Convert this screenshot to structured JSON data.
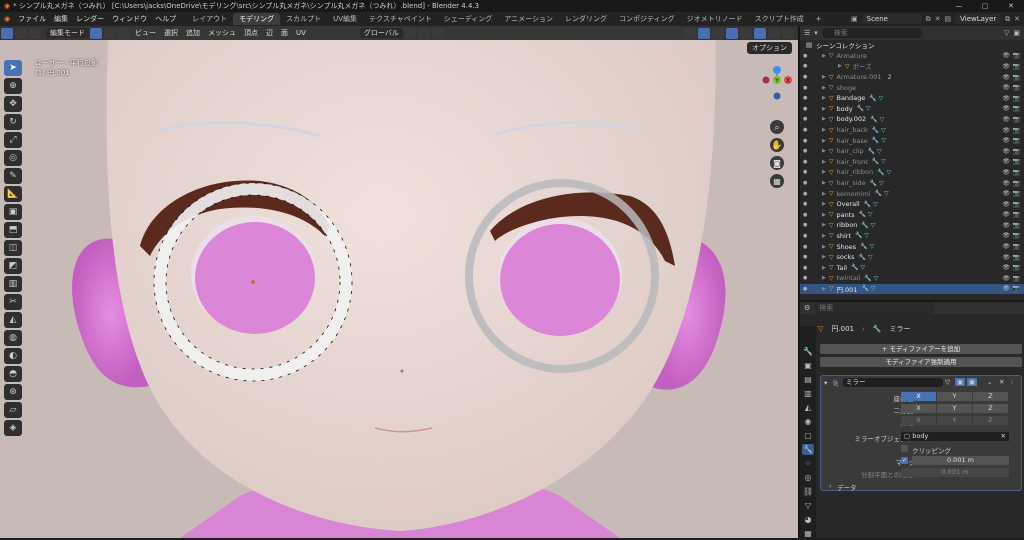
{
  "window": {
    "title": "* シンプル丸メガネ（つみれ） [C:\\Users\\jacks\\OneDrive\\モデリング\\src\\シンプル丸メガネ\\シンプル丸メガネ（つみれ）.blend] - Blender 4.4.3",
    "controls": [
      "—",
      "▢",
      "✕"
    ]
  },
  "menubar": {
    "menus": [
      "ファイル",
      "編集",
      "レンダー",
      "ウィンドウ",
      "ヘルプ"
    ],
    "workspaces": [
      "レイアウト",
      "モデリング",
      "スカルプト",
      "UV編集",
      "テクスチャペイント",
      "シェーディング",
      "アニメーション",
      "レンダリング",
      "コンポジティング",
      "ジオメトリノード",
      "スクリプト作成",
      "+"
    ],
    "active_workspace": "モデリング",
    "scene": "Scene",
    "view_layer": "ViewLayer"
  },
  "viewport": {
    "mode": "編集モード",
    "menus": [
      "ビュー",
      "選択",
      "追加",
      "メッシュ",
      "頂点",
      "辺",
      "面",
      "UV"
    ],
    "transform_orientation": "グローバル",
    "options": "オプション",
    "view_name": "ユーザー・平行投影",
    "object_name": "(1) 円.001",
    "gizmo_axes": [
      "X",
      "Y",
      "Z"
    ],
    "colors": {
      "x": "#e8474f",
      "y": "#7cc22e",
      "z": "#3f8ff2"
    }
  },
  "outliner": {
    "search_placeholder": "検索",
    "root": "シーンコレクション",
    "items": [
      {
        "label": "Armature",
        "dim": true,
        "sub": ""
      },
      {
        "label": "ポーズ",
        "dim": true,
        "sub": ""
      },
      {
        "label": "Armature.001",
        "dim": true,
        "sub": "2"
      },
      {
        "label": "shoge",
        "dim": true,
        "sub": ""
      },
      {
        "label": "Bandage",
        "dim": false,
        "sub": ""
      },
      {
        "label": "body",
        "dim": false,
        "sub": ""
      },
      {
        "label": "body.002",
        "dim": false,
        "sub": ""
      },
      {
        "label": "hair_back",
        "dim": true,
        "sub": ""
      },
      {
        "label": "hair_base",
        "dim": true,
        "sub": ""
      },
      {
        "label": "hair_clip",
        "dim": true,
        "sub": ""
      },
      {
        "label": "hair_front",
        "dim": true,
        "sub": ""
      },
      {
        "label": "hair_ribbon",
        "dim": true,
        "sub": ""
      },
      {
        "label": "hair_side",
        "dim": true,
        "sub": ""
      },
      {
        "label": "kemomimi",
        "dim": true,
        "sub": ""
      },
      {
        "label": "Overall",
        "dim": false,
        "sub": ""
      },
      {
        "label": "pants",
        "dim": false,
        "sub": ""
      },
      {
        "label": "ribbon",
        "dim": false,
        "sub": ""
      },
      {
        "label": "shirt",
        "dim": false,
        "sub": ""
      },
      {
        "label": "Shoes",
        "dim": false,
        "sub": ""
      },
      {
        "label": "socks",
        "dim": false,
        "sub": ""
      },
      {
        "label": "Tail",
        "dim": false,
        "sub": ""
      },
      {
        "label": "twintail",
        "dim": true,
        "sub": ""
      },
      {
        "label": "円.001",
        "dim": false,
        "sub": "",
        "selected": true
      }
    ]
  },
  "properties": {
    "search_placeholder": "検索",
    "breadcrumb_object": "円.001",
    "breadcrumb_modifier": "ミラー",
    "add_modifier": "モディファイアーを追加",
    "apply_modifier": "モディファイア強制適用",
    "modifier_name": "ミラー",
    "axis_label": "座標軸",
    "bisect_label": "二分割",
    "flip_label": "反転",
    "axes": [
      "X",
      "Y",
      "Z"
    ],
    "mirror_object_label": "ミラーオブジェクト",
    "mirror_object": "body",
    "clipping_label": "クリッピング",
    "merge_label": "マージ",
    "merge_value": "0.001 m",
    "bisect_distance_label": "分割平面との距離",
    "bisect_distance_value": "0.001 m",
    "data_label": "データ"
  }
}
